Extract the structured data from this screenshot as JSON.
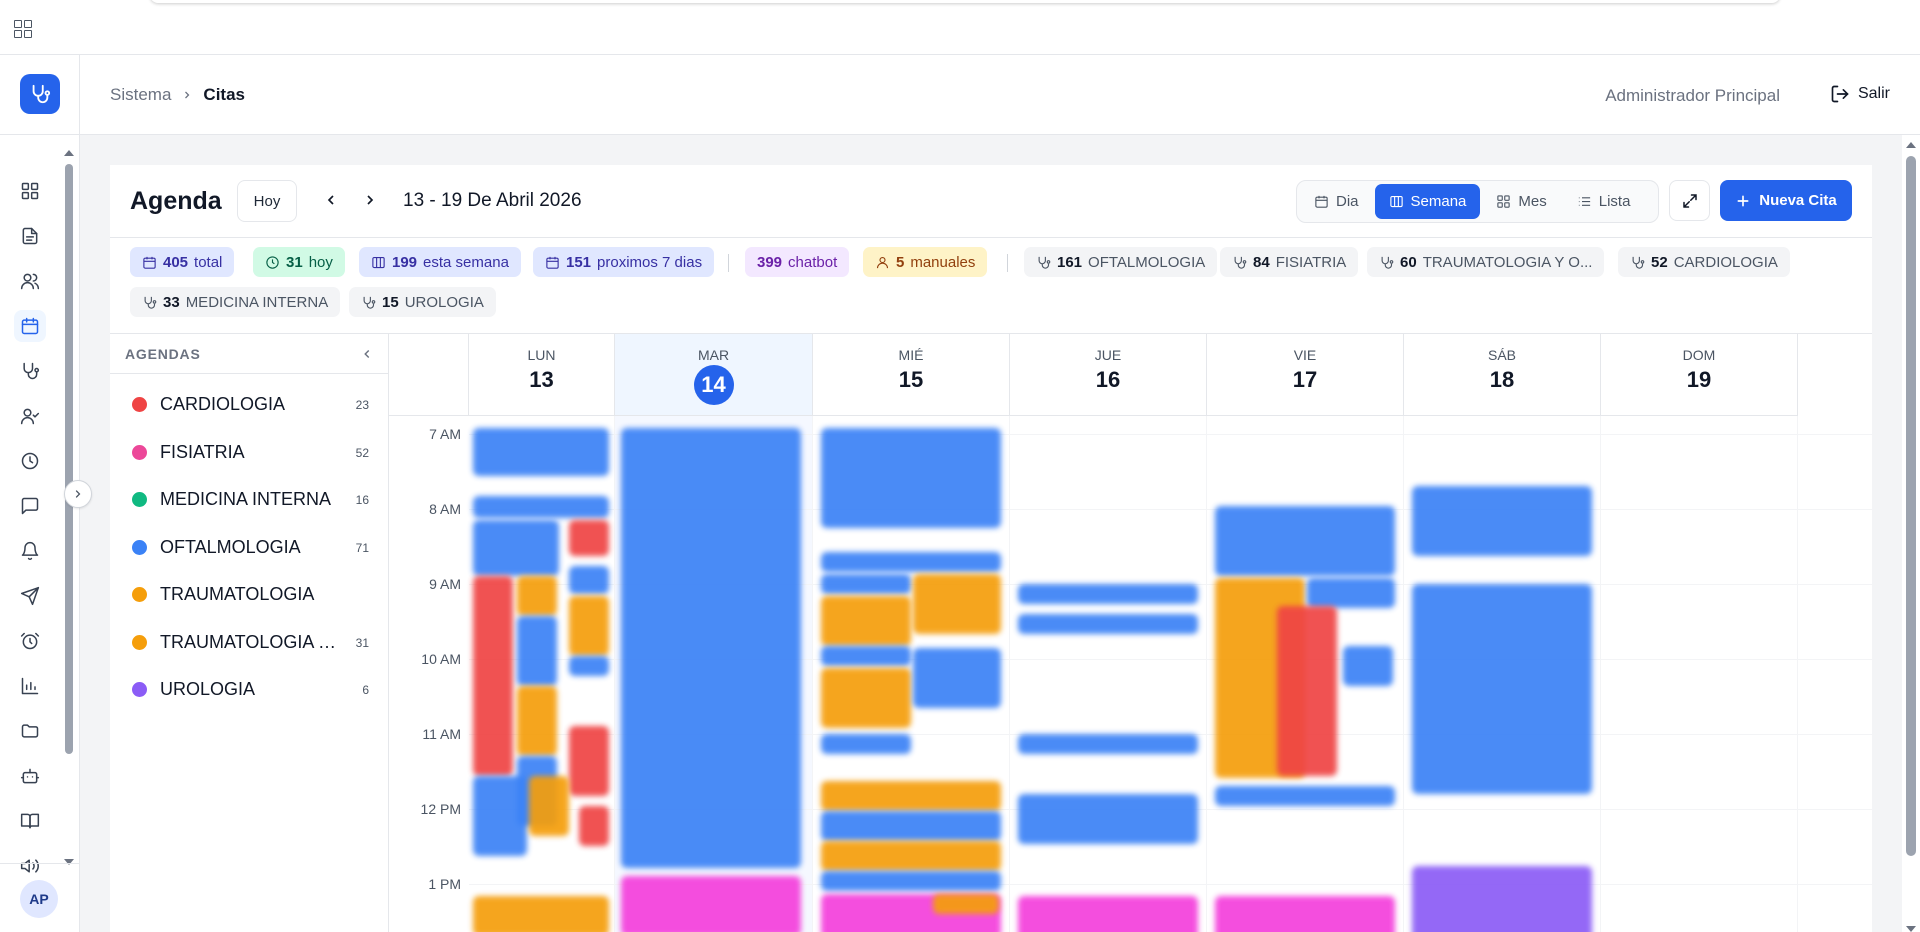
{
  "header": {
    "breadcrumb": [
      "Sistema",
      "Citas"
    ],
    "user_name": "Administrador Principal",
    "logout_label": "Salir"
  },
  "sidebar": {
    "logo_icon": "stethoscope-icon",
    "avatar_initials": "AP",
    "items": [
      {
        "icon": "dashboard-icon"
      },
      {
        "icon": "document-icon"
      },
      {
        "icon": "users-icon"
      },
      {
        "icon": "calendar-icon",
        "active": true
      },
      {
        "icon": "stethoscope-icon"
      },
      {
        "icon": "user-check-icon"
      },
      {
        "icon": "clock-icon"
      },
      {
        "icon": "chat-icon"
      },
      {
        "icon": "bell-icon"
      },
      {
        "icon": "send-icon"
      },
      {
        "icon": "alarm-icon"
      },
      {
        "icon": "chart-icon"
      },
      {
        "icon": "folder-icon"
      },
      {
        "icon": "bot-icon"
      },
      {
        "icon": "book-icon"
      },
      {
        "icon": "speaker-icon"
      }
    ]
  },
  "toolbar": {
    "title": "Agenda",
    "today_label": "Hoy",
    "range_label": "13 - 19 De Abril 2026",
    "views": [
      "Dia",
      "Semana",
      "Mes",
      "Lista"
    ],
    "active_view": "Semana",
    "new_label": "Nueva Cita"
  },
  "stats": [
    {
      "value": "405",
      "label": "total"
    },
    {
      "value": "31",
      "label": "hoy"
    },
    {
      "value": "199",
      "label": "esta semana"
    },
    {
      "value": "151",
      "label": "proximos 7 dias"
    },
    {
      "value": "399",
      "label": "chatbot"
    },
    {
      "value": "5",
      "label": "manuales"
    },
    {
      "value": "161",
      "label": "OFTALMOLOGIA"
    },
    {
      "value": "84",
      "label": "FISIATRIA"
    },
    {
      "value": "60",
      "label": "TRAUMATOLOGIA Y O..."
    },
    {
      "value": "52",
      "label": "CARDIOLOGIA"
    },
    {
      "value": "33",
      "label": "MEDICINA INTERNA"
    },
    {
      "value": "15",
      "label": "UROLOGIA"
    }
  ],
  "agendas": {
    "title": "AGENDAS",
    "items": [
      {
        "name": "CARDIOLOGIA",
        "count": "23",
        "color": "#ef4444"
      },
      {
        "name": "FISIATRIA",
        "count": "52",
        "color": "#ec4899"
      },
      {
        "name": "MEDICINA INTERNA",
        "count": "16",
        "color": "#10b981"
      },
      {
        "name": "OFTALMOLOGIA",
        "count": "71",
        "color": "#3b82f6"
      },
      {
        "name": "TRAUMATOLOGIA",
        "count": "",
        "color": "#f59e0b"
      },
      {
        "name": "TRAUMATOLOGIA Y ...",
        "count": "31",
        "color": "#f59e0b"
      },
      {
        "name": "UROLOGIA",
        "count": "6",
        "color": "#8b5cf6"
      }
    ]
  },
  "calendar": {
    "days": [
      {
        "name": "LUN",
        "num": "13"
      },
      {
        "name": "MAR",
        "num": "14",
        "today": true
      },
      {
        "name": "MIÉ",
        "num": "15"
      },
      {
        "name": "JUE",
        "num": "16"
      },
      {
        "name": "VIE",
        "num": "17"
      },
      {
        "name": "SÁB",
        "num": "18"
      },
      {
        "name": "DOM",
        "num": "19"
      }
    ],
    "hours": [
      "7 AM",
      "8 AM",
      "9 AM",
      "10 AM",
      "11 AM",
      "12 PM",
      "1 PM"
    ]
  }
}
